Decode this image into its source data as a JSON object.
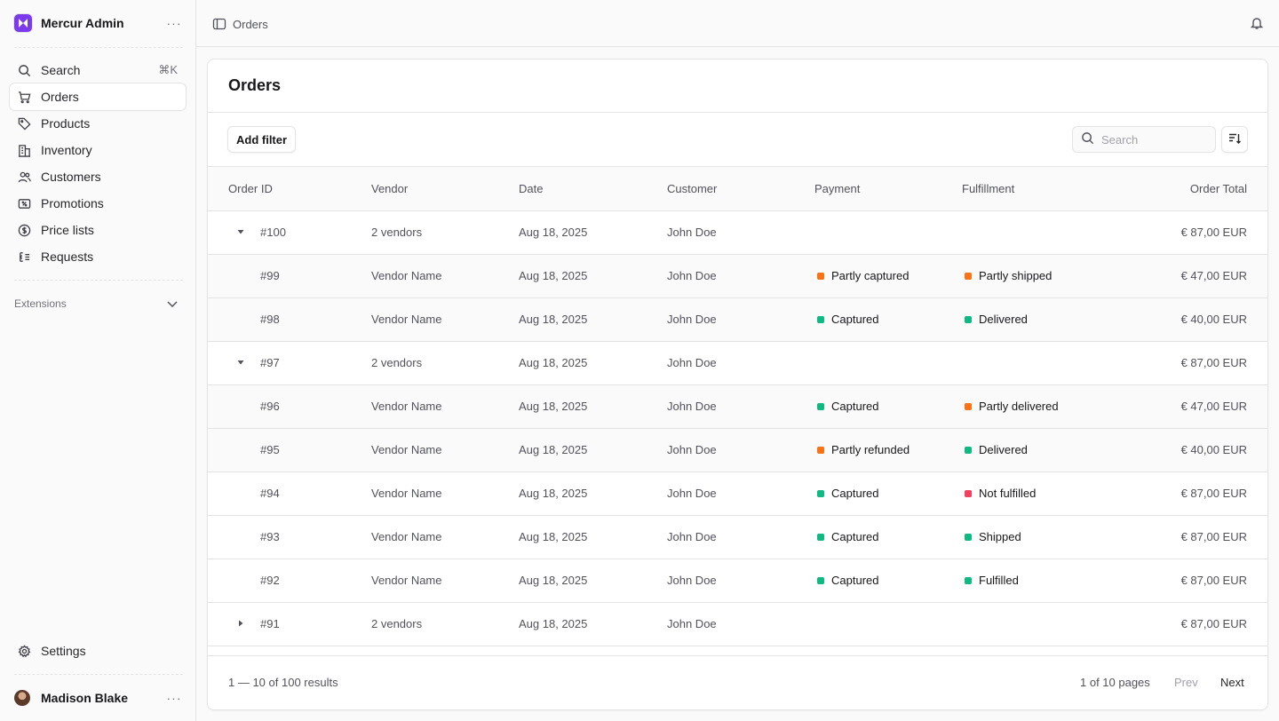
{
  "app": {
    "name": "Mercur Admin",
    "brand_color": "#7c3aed"
  },
  "sidebar": {
    "search": {
      "label": "Search",
      "shortcut": "⌘K"
    },
    "items": [
      {
        "label": "Orders",
        "icon": "cart-icon",
        "active": true
      },
      {
        "label": "Products",
        "icon": "tag-icon"
      },
      {
        "label": "Inventory",
        "icon": "buildings-icon"
      },
      {
        "label": "Customers",
        "icon": "users-icon"
      },
      {
        "label": "Promotions",
        "icon": "receipt-percent-icon"
      },
      {
        "label": "Price lists",
        "icon": "currency-dollar-icon"
      },
      {
        "label": "Requests",
        "icon": "arrow-path-icon"
      }
    ],
    "extensions_label": "Extensions",
    "settings_label": "Settings",
    "user_name": "Madison Blake"
  },
  "topbar": {
    "breadcrumb": "Orders"
  },
  "page": {
    "title": "Orders",
    "add_filter_label": "Add filter",
    "search_placeholder": "Search"
  },
  "table": {
    "columns": [
      "Order ID",
      "Vendor",
      "Date",
      "Customer",
      "Payment",
      "Fulfillment",
      "Order Total"
    ],
    "rows": [
      {
        "id": "#100",
        "vendor": "2 vendors",
        "date": "Aug 18, 2025",
        "customer": "John Doe",
        "payment": "",
        "fulfillment": "",
        "total": "€ 87,00 EUR",
        "expander": "expanded",
        "child": false
      },
      {
        "id": "#99",
        "vendor": "Vendor Name",
        "date": "Aug 18, 2025",
        "customer": "John Doe",
        "payment": "Partly captured",
        "payment_color": "#f97316",
        "fulfillment": "Partly shipped",
        "fulfillment_color": "#f97316",
        "total": "€ 47,00 EUR",
        "expander": "",
        "child": true
      },
      {
        "id": "#98",
        "vendor": "Vendor Name",
        "date": "Aug 18, 2025",
        "customer": "John Doe",
        "payment": "Captured",
        "payment_color": "#10b981",
        "fulfillment": "Delivered",
        "fulfillment_color": "#10b981",
        "total": "€ 40,00 EUR",
        "expander": "",
        "child": true
      },
      {
        "id": "#97",
        "vendor": "2 vendors",
        "date": "Aug 18, 2025",
        "customer": "John Doe",
        "payment": "",
        "fulfillment": "",
        "total": "€ 87,00 EUR",
        "expander": "expanded",
        "child": false
      },
      {
        "id": "#96",
        "vendor": "Vendor Name",
        "date": "Aug 18, 2025",
        "customer": "John Doe",
        "payment": "Captured",
        "payment_color": "#10b981",
        "fulfillment": "Partly delivered",
        "fulfillment_color": "#f97316",
        "total": "€ 47,00 EUR",
        "expander": "",
        "child": true
      },
      {
        "id": "#95",
        "vendor": "Vendor Name",
        "date": "Aug 18, 2025",
        "customer": "John Doe",
        "payment": "Partly refunded",
        "payment_color": "#f97316",
        "fulfillment": "Delivered",
        "fulfillment_color": "#10b981",
        "total": "€ 40,00 EUR",
        "expander": "",
        "child": true
      },
      {
        "id": "#94",
        "vendor": "Vendor Name",
        "date": "Aug 18, 2025",
        "customer": "John Doe",
        "payment": "Captured",
        "payment_color": "#10b981",
        "fulfillment": "Not fulfilled",
        "fulfillment_color": "#f43f5e",
        "total": "€ 87,00 EUR",
        "expander": "",
        "child": false
      },
      {
        "id": "#93",
        "vendor": "Vendor Name",
        "date": "Aug 18, 2025",
        "customer": "John Doe",
        "payment": "Captured",
        "payment_color": "#10b981",
        "fulfillment": "Shipped",
        "fulfillment_color": "#10b981",
        "total": "€ 87,00 EUR",
        "expander": "",
        "child": false
      },
      {
        "id": "#92",
        "vendor": "Vendor Name",
        "date": "Aug 18, 2025",
        "customer": "John Doe",
        "payment": "Captured",
        "payment_color": "#10b981",
        "fulfillment": "Fulfilled",
        "fulfillment_color": "#10b981",
        "total": "€ 87,00 EUR",
        "expander": "",
        "child": false
      },
      {
        "id": "#91",
        "vendor": "2 vendors",
        "date": "Aug 18, 2025",
        "customer": "John Doe",
        "payment": "",
        "fulfillment": "",
        "total": "€ 87,00 EUR",
        "expander": "collapsed",
        "child": false
      }
    ]
  },
  "pagination": {
    "results": "1 — 10 of 100 results",
    "pages": "1 of 10 pages",
    "prev_label": "Prev",
    "next_label": "Next"
  }
}
